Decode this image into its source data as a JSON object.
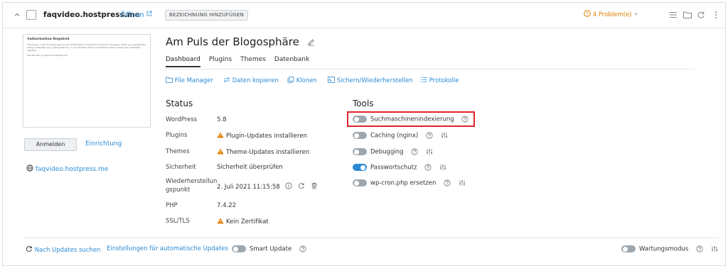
{
  "site": {
    "name": "faqvideo.hostpress.me",
    "open_label": "Öffnen",
    "tag_button": "BEZEICHNUNG HINZUFÜGEN",
    "problems": "4 Problem(e)"
  },
  "preview": {
    "title": "Authorization Required",
    "text1": "This server could not verify that you are authorized to access the document requested. Either you supplied the wrong credentials (e.g., bad password), or your browser doesn't understand how to supply the credentials required.",
    "text2": "Add the info on support hostpress.me"
  },
  "left": {
    "login_label": "Anmelden",
    "setup_label": "Einrichtung",
    "site_link": "faqvideo.hostpress.me"
  },
  "main": {
    "title": "Am Puls der Blogosphäre",
    "tabs": [
      {
        "label": "Dashboard"
      },
      {
        "label": "Plugins"
      },
      {
        "label": "Themes"
      },
      {
        "label": "Datenbank"
      }
    ],
    "actions": [
      {
        "label": "File Manager"
      },
      {
        "label": "Daten kopieren"
      },
      {
        "label": "Klonen"
      },
      {
        "label": "Sichern/Wiederherstellen"
      },
      {
        "label": "Protokolle"
      }
    ]
  },
  "status": {
    "title": "Status",
    "rows": [
      {
        "label": "WordPress",
        "value": "5.8"
      },
      {
        "label": "Plugins",
        "value": "Plugin-Updates installieren"
      },
      {
        "label": "Themes",
        "value": "Theme-Updates installieren"
      },
      {
        "label": "Sicherheit",
        "value": "Sicherheit überprüfen"
      },
      {
        "label": "Wiederherstellungspunkt",
        "label_line1": "Wiederherstellun",
        "label_line2": "gspunkt",
        "value": "2. Juli 2021 11:15:58"
      },
      {
        "label": "PHP",
        "value": "7.4.22"
      },
      {
        "label": "SSL/TLS",
        "value": "Kein Zertifikat"
      }
    ]
  },
  "tools": {
    "title": "Tools",
    "items": [
      {
        "label": "Suchmaschinenindexierung",
        "enabled": false
      },
      {
        "label": "Caching (nginx)",
        "enabled": false
      },
      {
        "label": "Debugging",
        "enabled": false
      },
      {
        "label": "Passwortschutz",
        "enabled": true
      },
      {
        "label": "wp-cron.php ersetzen",
        "enabled": false
      }
    ]
  },
  "footer": {
    "check_updates": "Nach Updates suchen",
    "auto_updates": "Einstellungen für automatische Updates",
    "smart_update": "Smart Update",
    "maintenance": "Wartungsmodus"
  },
  "colors": {
    "accent": "#2a8ad4",
    "warning": "#e07e00",
    "highlight": "#e0222c"
  }
}
